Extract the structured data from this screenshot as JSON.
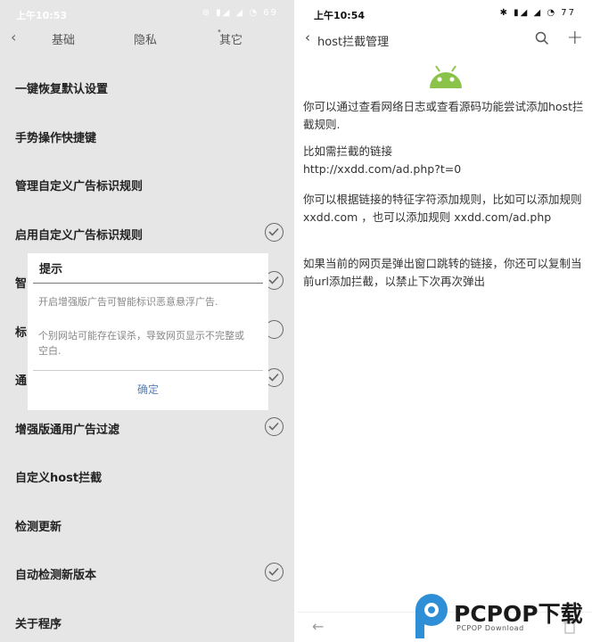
{
  "left": {
    "status": {
      "time": "上午10:53",
      "icons": "⊚ ▮◢ ◢ ◔ 69"
    },
    "tabs": {
      "back_icon": "chevron-left-icon",
      "items": [
        "基础",
        "隐私",
        "其它"
      ]
    },
    "settings": [
      {
        "label": "一键恢复默认设置",
        "check": false
      },
      {
        "label": "手势操作快捷键",
        "check": false
      },
      {
        "label": "管理自定义广告标识规则",
        "check": false
      },
      {
        "label": "启用自定义广告标识规则",
        "check": true,
        "checked": true
      },
      {
        "label": "智",
        "check": true,
        "checked": true
      },
      {
        "label": "标",
        "check": true,
        "checked": false
      },
      {
        "label": "通",
        "check": true,
        "checked": true
      },
      {
        "label": "增强版通用广告过滤",
        "check": true,
        "checked": true
      },
      {
        "label": "自定义host拦截",
        "check": false
      },
      {
        "label": "检测更新",
        "check": false
      },
      {
        "label": "自动检测新版本",
        "check": true,
        "checked": true
      },
      {
        "label": "关于程序",
        "check": false
      }
    ],
    "dialog": {
      "title": "提示",
      "p1": "开启增强版广告可智能标识恶意悬浮广告.",
      "p2": "个别网站可能存在误杀，导致网页显示不完整或空白.",
      "ok": "确定"
    }
  },
  "right": {
    "status": {
      "time": "上午10:54",
      "icons": "✱ ▮◢ ◢ ◔ 77"
    },
    "header": {
      "title": "host拦截管理",
      "back_icon": "chevron-left-icon",
      "search_icon": "search-icon",
      "add_icon": "plus-icon"
    },
    "paragraphs": [
      "你可以通过查看网络日志或查看源码功能尝试添加host拦截规则.",
      "比如需拦截的链接\nhttp://xxdd.com/ad.php?t=0",
      "你可以根据链接的特征字符添加规则，比如可以添加规则xxdd.com ，也可以添加规则 xxdd.com/ad.php",
      "如果当前的网页是弹出窗口跳转的链接，你还可以复制当前url添加拦截，以禁止下次再次弹出"
    ],
    "footer": {
      "back_icon": "arrow-left-icon",
      "trash_icon": "trash-icon"
    }
  },
  "watermark": {
    "text": "PCPOP下载",
    "sub": "PCPOP Download"
  },
  "colors": {
    "android_green": "#8bc34a",
    "left_bg": "#e6e6e6",
    "dialog_link": "#5a7fb0"
  }
}
